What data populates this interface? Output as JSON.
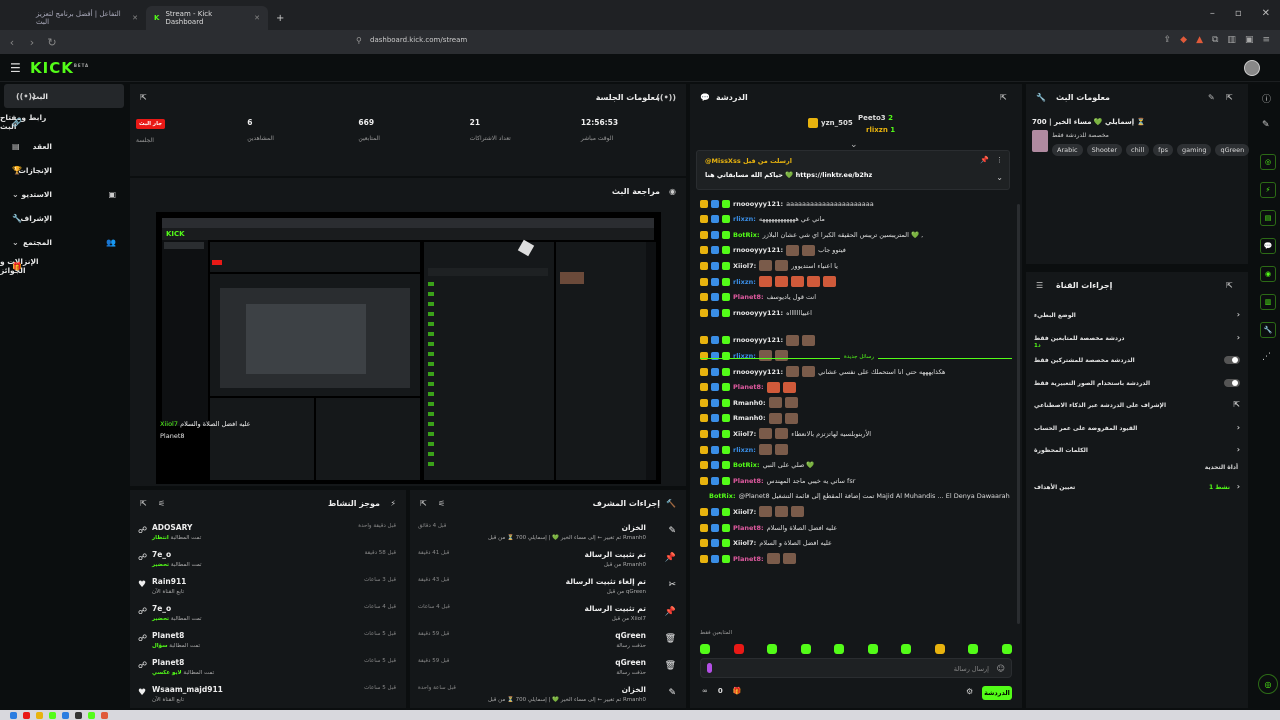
{
  "browser": {
    "tabs": [
      {
        "title": "التفاعل | أفضل برنامج لتعزيز البث"
      },
      {
        "title": "Stream - Kick Dashboard"
      }
    ],
    "url": "dashboard.kick.com/stream"
  },
  "app": {
    "logo": "KICK",
    "logo_sup": "BETA"
  },
  "sidebar": {
    "items": [
      {
        "label": "البث"
      },
      {
        "label": "رابط ومفتاح البث"
      },
      {
        "label": "العقد"
      },
      {
        "label": "الإنجازات"
      },
      {
        "label": "الاستديو"
      },
      {
        "label": "الإشراف"
      },
      {
        "label": "المجتمع"
      },
      {
        "label": "الإنزالات و الجوائز"
      }
    ]
  },
  "session": {
    "title": "معلومات الجلسة",
    "live_badge": "جار البث",
    "stats": [
      {
        "value": "",
        "label": "الجلسة"
      },
      {
        "value": "6",
        "label": "المشاهدين"
      },
      {
        "value": "669",
        "label": "المتابعين"
      },
      {
        "value": "21",
        "label": "تعداد الاشتراكات"
      },
      {
        "value": "12:56:53",
        "label": "الوقت مباشر"
      }
    ]
  },
  "preview": {
    "title": "مراجعة البث",
    "overlay1": "عليه افضل الصلاة والسلام",
    "overlay2": "Xiiol7",
    "overlay3": "Planet8"
  },
  "activity": {
    "title": "موجز النشاط",
    "rows": [
      {
        "name": "ADOSARY",
        "sub": "تمت المطالبة",
        "hl": "انتظار",
        "time": "قبل دقيقة واحدة"
      },
      {
        "name": "7e_o",
        "sub": "تمت المطالبة",
        "hl": "تحضير",
        "time": "قبل 58 دقيقة"
      },
      {
        "name": "Rain911",
        "sub": "تابع القناة الآن",
        "hl": "",
        "time": "قبل 3 ساعات"
      },
      {
        "name": "7e_o",
        "sub": "تمت المطالبة",
        "hl": "تحضير",
        "time": "قبل 4 ساعات"
      },
      {
        "name": "Planet8",
        "sub": "تمت المطالبة",
        "hl": "سؤال",
        "time": "قبل 5 ساعات"
      },
      {
        "name": "Planet8",
        "sub": "تمت المطالبة",
        "hl": "لايو عكسي",
        "time": "قبل 5 ساعات"
      },
      {
        "name": "Wsaam_majd911",
        "sub": "تابع القناة الآن",
        "hl": "",
        "time": "قبل 5 ساعات"
      }
    ]
  },
  "mod": {
    "title": "إجراءات المشرف",
    "rows": [
      {
        "name": "الخزان",
        "sub": "تم تغيير ← إلى مساء الخير 💚 | إسمايلي 700 ⏳ من قبل Rmanh0",
        "time": "قبل 4 دقائق"
      },
      {
        "name": "تم تثبيت الرسالة",
        "sub": "من قبل Rmanh0",
        "time": "قبل 41 دقيقة"
      },
      {
        "name": "تم إلغاء تثبيت الرسالة",
        "sub": "من قبل qGreen",
        "time": "قبل 43 دقيقة"
      },
      {
        "name": "تم تثبيت الرسالة",
        "sub": "من قبل Xiiol7",
        "time": "قبل 4 ساعات"
      },
      {
        "name": "qGreen",
        "sub": "حذفت رسالة",
        "time": "قبل 59 دقيقة"
      },
      {
        "name": "qGreen",
        "sub": "حذفت رسالة",
        "time": "قبل 59 دقيقة"
      },
      {
        "name": "الخزان",
        "sub": "تم تغيير ← إلى مساء الخير 💚 | إسمايلي 700 ⏳ من قبل Rmanh0",
        "time": "قبل ساعة واحدة"
      }
    ]
  },
  "chat": {
    "title": "الدردشة",
    "top": [
      {
        "name": "yzn_505",
        "count": "1"
      },
      {
        "name": "Peeto3",
        "count": "2"
      },
      {
        "name": "rlixzn",
        "count": "1"
      }
    ],
    "pinned_author": "@MissXss ارسلت من قبل",
    "pinned_text": "حياكم الله مسابقاتي هنا 💚 https://linktr.ee/b2hz",
    "messages": [
      {
        "user": "rnoooyyy121:",
        "text": "aaaaaaaaaaaaaaaaaaaaaa",
        "color": "#e8e8e8"
      },
      {
        "user": "rlixzn:",
        "text": "ماني عي ههههههههههههه",
        "color": "#3a8ee6"
      },
      {
        "user": "BotRix:",
        "text": "المتريبسين تريبس الحقيقه الكبرا اي شي عشان البلازر 💚 ,",
        "color": "#53fc18"
      },
      {
        "user": "rnoooyyy121:",
        "text": "فيتوو جاب",
        "color": "#e8e8e8"
      },
      {
        "user": "Xiiol7:",
        "text": "يا اعنياء استديوور",
        "color": "#e8e8e8"
      },
      {
        "user": "rlixzn:",
        "text": "",
        "color": "#3a8ee6"
      },
      {
        "user": "Planet8:",
        "text": "انت قول ياديوسف",
        "color": "#e05aa0"
      },
      {
        "user": "rnoooyyy121:",
        "text": "اعيياااااااه",
        "color": "#e8e8e8"
      },
      {
        "user": "rnoooyyy121:",
        "text": "",
        "color": "#e8e8e8"
      },
      {
        "user": "rlixzn:",
        "text": "",
        "color": "#3a8ee6"
      },
      {
        "user": "rnoooyyy121:",
        "text": "هكذايهههه حتي انا استحملك على نفسي عشاني",
        "color": "#e8e8e8"
      },
      {
        "user": "Planet8:",
        "text": "",
        "color": "#e05aa0"
      },
      {
        "user": "Rmanh0:",
        "text": "",
        "color": "#e8e8e8"
      },
      {
        "user": "Rmanh0:",
        "text": "",
        "color": "#e8e8e8"
      },
      {
        "user": "Xiiol7:",
        "text": "الأربنوبلسيه لهاتزتزم بالانعطاء",
        "color": "#e8e8e8"
      },
      {
        "user": "rlixzn:",
        "text": "",
        "color": "#3a8ee6"
      },
      {
        "user": "BotRix:",
        "text": "صلي على النبي 💚",
        "color": "#53fc18"
      },
      {
        "user": "Planet8:",
        "text": "ساتي يه خيبي ماجد المهندس fsr",
        "color": "#e05aa0"
      },
      {
        "user": "BotRix:",
        "text": "@Planet8 تمت إضافة المقطع إلى قائمة التشغيل Majid Al Muhandis ... El Denya Dawaarah | ماجد المهندس ... الدنيا دوارة - فبراير الكويت 2020",
        "color": "#53fc18"
      },
      {
        "user": "Xiiol7:",
        "text": "",
        "color": "#e8e8e8"
      },
      {
        "user": "Planet8:",
        "text": "عليه افضل الصلاة والسلام",
        "color": "#e05aa0"
      },
      {
        "user": "Xiiol7:",
        "text": "عليه افضل الصلاة و السلام",
        "color": "#e8e8e8"
      },
      {
        "user": "Planet8:",
        "text": "",
        "color": "#e05aa0"
      }
    ],
    "new_messages_label": "رسائل جديدة",
    "mods_only": "المتابعين فقط",
    "input_placeholder": "إرسال رسالة",
    "send_label": "الدردشة",
    "viewer_count": "0"
  },
  "stream_info": {
    "title": "معلومات البث",
    "stream_title": "700 | إسمايلي 💚 مساء الخير ⏳",
    "category": "مخصصة للدردشة فقط",
    "tags": [
      "Arabic",
      "Shooter",
      "chill",
      "fps",
      "gaming",
      "qGreen"
    ]
  },
  "channel_actions": {
    "title": "إجراءات القناة",
    "rows": [
      {
        "label": "الوضع البطيء",
        "kind": "chev"
      },
      {
        "label": "دردشة مخصصة للمتابعين فقط",
        "kind": "chev",
        "sub": "1د"
      },
      {
        "label": "الدردشة مخصصة للمشتركين فقط",
        "kind": "toggle"
      },
      {
        "label": "الدردشة باستخدام الصور التعبيرية فقط",
        "kind": "toggle"
      },
      {
        "label": "الإشراف على الدردشة عبر الذكاء الاصطناعي",
        "kind": "ext"
      },
      {
        "label": "القيود المفروضة على عمر الحساب",
        "kind": "chev"
      },
      {
        "label": "الكلمات المحظورة",
        "kind": "chev"
      }
    ],
    "goals_label": "أداة التحدية",
    "goals_row": "تعيين الأهداف",
    "goals_status": "نشط 1"
  },
  "colors": {
    "accent": "#53fc18",
    "live": "#e91916",
    "bg": "#0b0e0f",
    "panel": "#141719"
  }
}
